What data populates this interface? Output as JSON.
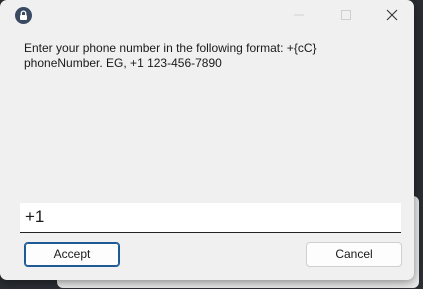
{
  "window": {
    "icon": "lock-icon",
    "controls": [
      "minimize-icon",
      "maximize-icon",
      "close-icon"
    ]
  },
  "prompt": {
    "line1": "Enter your phone number in the following format: +{cC}",
    "line2": "phoneNumber. EG, +1 123-456-7890"
  },
  "input": {
    "value": "+1"
  },
  "buttons": {
    "accept": "Accept",
    "cancel": "Cancel"
  },
  "colors": {
    "dialog_bg": "#f0f0f0",
    "accent_border": "#1f5a94",
    "backdrop": "#2a2d33"
  }
}
